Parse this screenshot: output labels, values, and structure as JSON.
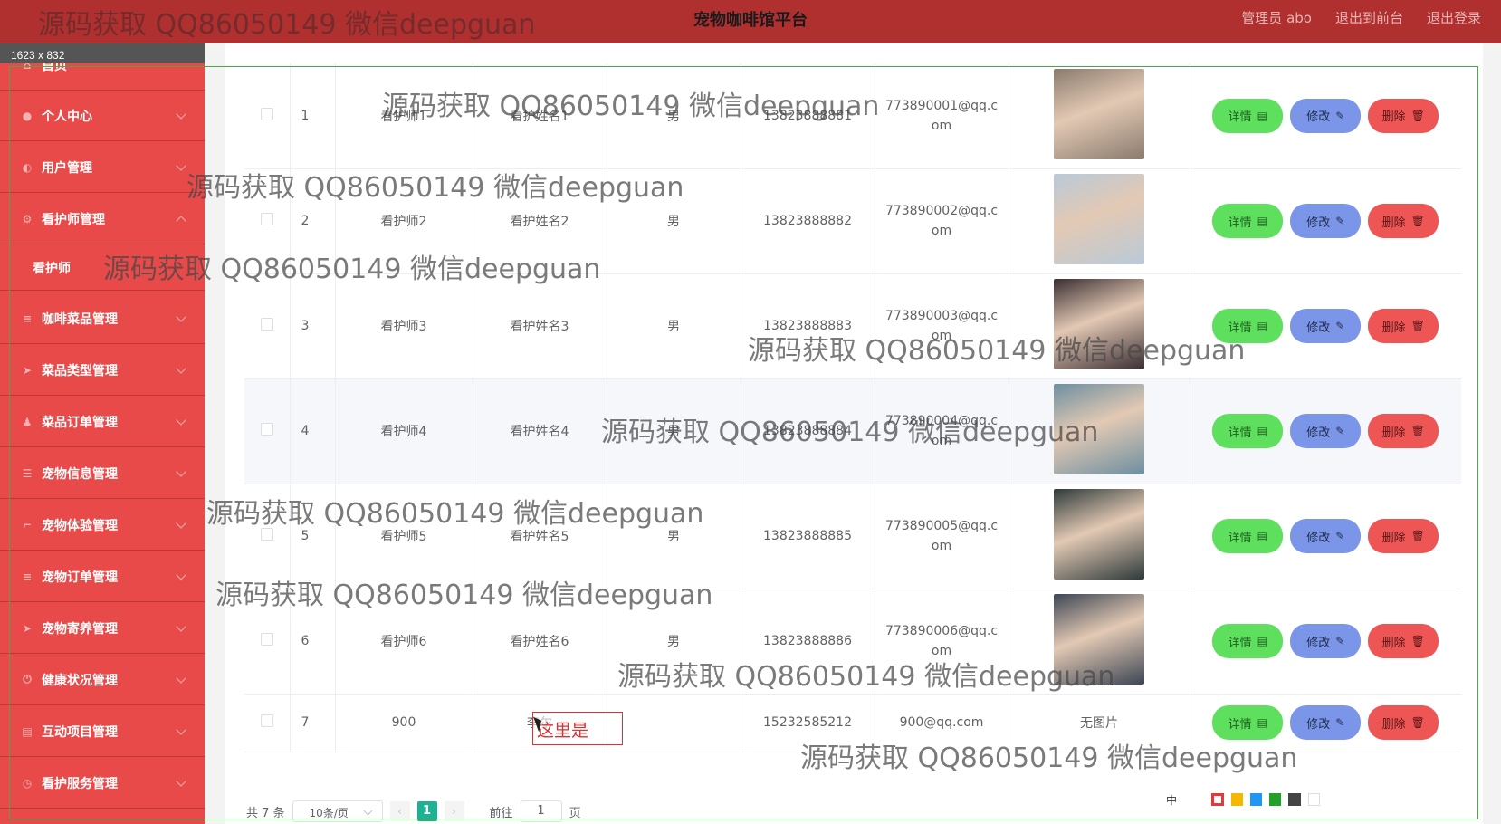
{
  "app": {
    "title": "宠物咖啡馆平台"
  },
  "header": {
    "admin_label": "管理员 abo",
    "to_front_label": "退出到前台",
    "logout_label": "退出登录"
  },
  "overlay": {
    "dimensions_label": "1623 x 832",
    "annotation_text": "这里是",
    "palette_lang": "中"
  },
  "watermark": "源码获取 QQ86050149 微信deepguan",
  "sidebar": {
    "items": [
      {
        "label": "首页",
        "icon": "home-icon"
      },
      {
        "label": "个人中心",
        "icon": "user-icon"
      },
      {
        "label": "用户管理",
        "icon": "users-icon"
      },
      {
        "label": "看护师管理",
        "icon": "settings-icon",
        "expanded": true
      },
      {
        "label": "咖啡菜品管理",
        "icon": "list-icon"
      },
      {
        "label": "菜品类型管理",
        "icon": "send-icon"
      },
      {
        "label": "菜品订单管理",
        "icon": "person-icon"
      },
      {
        "label": "宠物信息管理",
        "icon": "sliders-icon"
      },
      {
        "label": "宠物体验管理",
        "icon": "crop-icon"
      },
      {
        "label": "宠物订单管理",
        "icon": "list-icon"
      },
      {
        "label": "宠物寄养管理",
        "icon": "send-icon"
      },
      {
        "label": "健康状况管理",
        "icon": "power-icon"
      },
      {
        "label": "互动项目管理",
        "icon": "file-icon"
      },
      {
        "label": "看护服务管理",
        "icon": "clock-icon"
      }
    ],
    "sub_item": "看护师"
  },
  "table": {
    "rows": [
      {
        "idx": "1",
        "account": "看护师1",
        "name": "看护姓名1",
        "sex": "男",
        "phone": "13823888881",
        "email": "773890001@qq.com",
        "photo": "#8a7b6e"
      },
      {
        "idx": "2",
        "account": "看护师2",
        "name": "看护姓名2",
        "sex": "男",
        "phone": "13823888882",
        "email": "773890002@qq.com",
        "photo": "#b9c9d8"
      },
      {
        "idx": "3",
        "account": "看护师3",
        "name": "看护姓名3",
        "sex": "男",
        "phone": "13823888883",
        "email": "773890003@qq.com",
        "photo": "#3a2e33"
      },
      {
        "idx": "4",
        "account": "看护师4",
        "name": "看护姓名4",
        "sex": "男",
        "phone": "13823888884",
        "email": "773890004@qq.com",
        "photo": "#6d8fa0"
      },
      {
        "idx": "5",
        "account": "看护师5",
        "name": "看护姓名5",
        "sex": "男",
        "phone": "13823888885",
        "email": "773890005@qq.com",
        "photo": "#2e3a3a"
      },
      {
        "idx": "6",
        "account": "看护师6",
        "name": "看护姓名6",
        "sex": "男",
        "phone": "13823888886",
        "email": "773890006@qq.com",
        "photo": "#3d4654"
      },
      {
        "idx": "7",
        "account": "900",
        "name": "李尔",
        "sex": "",
        "phone": "15232585212",
        "email": "900@qq.com",
        "photo_text": "无图片"
      }
    ],
    "ops": {
      "detail": "详情",
      "edit": "修改",
      "delete": "删除"
    }
  },
  "pagination": {
    "total": "共 7 条",
    "page_size": "10条/页",
    "current_page": "1",
    "goto_label": "前往",
    "goto_value": "1",
    "page_unit": "页"
  },
  "colors": {
    "topbar": "#b03030",
    "sidebar": "#e84a4a",
    "detail": "#5ee05e",
    "edit": "#7b95e8",
    "delete": "#ee5656",
    "page_active": "#1ab394"
  },
  "palette_swatches": [
    "#e53935",
    "#f5b800",
    "#2196f3",
    "#22a02a",
    "#444444",
    "#ffffff"
  ]
}
